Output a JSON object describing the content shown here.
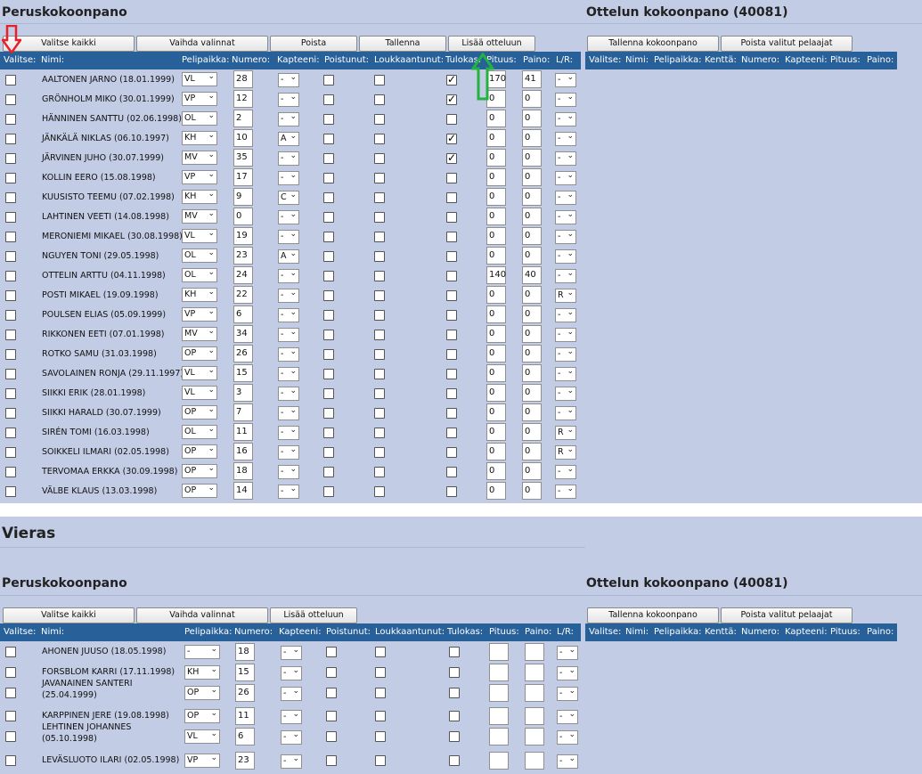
{
  "home": {
    "base_title": "Peruskokoonpano",
    "match_title": "Ottelun kokoonpano (40081)",
    "buttons": {
      "select_all": "Valitse kaikki",
      "invert": "Vaihda valinnat",
      "remove": "Poista",
      "save": "Tallenna",
      "add_to_match": "Lisää otteluun"
    },
    "match_buttons": {
      "save_lineup": "Tallenna kokoonpano",
      "remove_selected": "Poista valitut pelaajat"
    },
    "columns": {
      "select": "Valitse:",
      "name": "Nimi:",
      "position": "Pelipaikka:",
      "number": "Numero:",
      "captain": "Kapteeni:",
      "left": "Poistunut:",
      "injured": "Loukkaantunut:",
      "newcomer": "Tulokas:",
      "height": "Pituus:",
      "weight": "Paino:",
      "lr": "L/R:"
    },
    "match_columns": {
      "select": "Valitse:",
      "name": "Nimi:",
      "position": "Pelipaikka:",
      "field": "Kenttä:",
      "number": "Numero:",
      "captain": "Kapteeni:",
      "height": "Pituus:",
      "weight": "Paino:"
    },
    "players": [
      {
        "name": "AALTONEN JARNO (18.01.1999)",
        "position": "VL",
        "number": "28",
        "captain": "-",
        "newcomer": true,
        "height": "170",
        "weight": "41",
        "lr": "-"
      },
      {
        "name": "GRÖNHOLM MIKO (30.01.1999)",
        "position": "VP",
        "number": "12",
        "captain": "-",
        "newcomer": true,
        "height": "0",
        "weight": "0",
        "lr": "-"
      },
      {
        "name": "HÄNNINEN SANTTU (02.06.1998)",
        "position": "OL",
        "number": "2",
        "captain": "-",
        "newcomer": false,
        "height": "0",
        "weight": "0",
        "lr": "-"
      },
      {
        "name": "JÄNKÄLÄ NIKLAS (06.10.1997)",
        "position": "KH",
        "number": "10",
        "captain": "A",
        "newcomer": true,
        "height": "0",
        "weight": "0",
        "lr": "-"
      },
      {
        "name": "JÄRVINEN JUHO (30.07.1999)",
        "position": "MV",
        "number": "35",
        "captain": "-",
        "newcomer": true,
        "height": "0",
        "weight": "0",
        "lr": "-"
      },
      {
        "name": "KOLLIN EERO (15.08.1998)",
        "position": "VP",
        "number": "17",
        "captain": "-",
        "newcomer": false,
        "height": "0",
        "weight": "0",
        "lr": "-"
      },
      {
        "name": "KUUSISTO TEEMU (07.02.1998)",
        "position": "KH",
        "number": "9",
        "captain": "C",
        "newcomer": false,
        "height": "0",
        "weight": "0",
        "lr": "-"
      },
      {
        "name": "LAHTINEN VEETI (14.08.1998)",
        "position": "MV",
        "number": "0",
        "captain": "-",
        "newcomer": false,
        "height": "0",
        "weight": "0",
        "lr": "-"
      },
      {
        "name": "MERONIEMI MIKAEL (30.08.1998)",
        "position": "VL",
        "number": "19",
        "captain": "-",
        "newcomer": false,
        "height": "0",
        "weight": "0",
        "lr": "-"
      },
      {
        "name": "NGUYEN TONI (29.05.1998)",
        "position": "OL",
        "number": "23",
        "captain": "A",
        "newcomer": false,
        "height": "0",
        "weight": "0",
        "lr": "-"
      },
      {
        "name": "OTTELIN ARTTU (04.11.1998)",
        "position": "OL",
        "number": "24",
        "captain": "-",
        "newcomer": false,
        "height": "140",
        "weight": "40",
        "lr": "-"
      },
      {
        "name": "POSTI MIKAEL (19.09.1998)",
        "position": "KH",
        "number": "22",
        "captain": "-",
        "newcomer": false,
        "height": "0",
        "weight": "0",
        "lr": "R"
      },
      {
        "name": "POULSEN ELIAS (05.09.1999)",
        "position": "VP",
        "number": "6",
        "captain": "-",
        "newcomer": false,
        "height": "0",
        "weight": "0",
        "lr": "-"
      },
      {
        "name": "RIKKONEN EETI (07.01.1998)",
        "position": "MV",
        "number": "34",
        "captain": "-",
        "newcomer": false,
        "height": "0",
        "weight": "0",
        "lr": "-"
      },
      {
        "name": "ROTKO SAMU (31.03.1998)",
        "position": "OP",
        "number": "26",
        "captain": "-",
        "newcomer": false,
        "height": "0",
        "weight": "0",
        "lr": "-"
      },
      {
        "name": "SAVOLAINEN RONJA (29.11.1997)",
        "position": "VL",
        "number": "15",
        "captain": "-",
        "newcomer": false,
        "height": "0",
        "weight": "0",
        "lr": "-"
      },
      {
        "name": "SIIKKI ERIK (28.01.1998)",
        "position": "VL",
        "number": "3",
        "captain": "-",
        "newcomer": false,
        "height": "0",
        "weight": "0",
        "lr": "-"
      },
      {
        "name": "SIIKKI HARALD (30.07.1999)",
        "position": "OP",
        "number": "7",
        "captain": "-",
        "newcomer": false,
        "height": "0",
        "weight": "0",
        "lr": "-"
      },
      {
        "name": "SIRÉN TOMI (16.03.1998)",
        "position": "OL",
        "number": "11",
        "captain": "-",
        "newcomer": false,
        "height": "0",
        "weight": "0",
        "lr": "R"
      },
      {
        "name": "SOIKKELI ILMARI (02.05.1998)",
        "position": "OP",
        "number": "16",
        "captain": "-",
        "newcomer": false,
        "height": "0",
        "weight": "0",
        "lr": "R"
      },
      {
        "name": "TERVOMAA ERKKA (30.09.1998)",
        "position": "OP",
        "number": "18",
        "captain": "-",
        "newcomer": false,
        "height": "0",
        "weight": "0",
        "lr": "-"
      },
      {
        "name": "VÄLBE KLAUS (13.03.1998)",
        "position": "OP",
        "number": "14",
        "captain": "-",
        "newcomer": false,
        "height": "0",
        "weight": "0",
        "lr": "-"
      }
    ]
  },
  "away": {
    "section_title": "Vieras",
    "base_title": "Peruskokoonpano",
    "match_title": "Ottelun kokoonpano (40081)",
    "buttons": {
      "select_all": "Valitse kaikki",
      "invert": "Vaihda valinnat",
      "add_to_match": "Lisää otteluun"
    },
    "match_buttons": {
      "save_lineup": "Tallenna kokoonpano",
      "remove_selected": "Poista valitut pelaajat"
    },
    "columns": {
      "select": "Valitse:",
      "name": "Nimi:",
      "position": "Pelipaikka:",
      "number": "Numero:",
      "captain": "Kapteeni:",
      "left": "Poistunut:",
      "injured": "Loukkaantunut:",
      "newcomer": "Tulokas:",
      "height": "Pituus:",
      "weight": "Paino:",
      "lr": "L/R:"
    },
    "match_columns": {
      "select": "Valitse:",
      "name": "Nimi:",
      "position": "Pelipaikka:",
      "field": "Kenttä:",
      "number": "Numero:",
      "captain": "Kapteeni:",
      "height": "Pituus:",
      "weight": "Paino:"
    },
    "players": [
      {
        "name": "AHONEN JUUSO (18.05.1998)",
        "position": "-",
        "number": "18",
        "captain": "-",
        "height": "",
        "weight": "",
        "lr": "-"
      },
      {
        "name": "FORSBLOM KARRI (17.11.1998)",
        "position": "KH",
        "number": "15",
        "captain": "-",
        "height": "",
        "weight": "",
        "lr": "-"
      },
      {
        "name": "JAVANAINEN SANTERI (25.04.1999)",
        "position": "OP",
        "number": "26",
        "captain": "-",
        "height": "",
        "weight": "",
        "lr": "-"
      },
      {
        "name": "KARPPINEN JERE (19.08.1998)",
        "position": "OP",
        "number": "11",
        "captain": "-",
        "height": "",
        "weight": "",
        "lr": "-"
      },
      {
        "name": "LEHTINEN JOHANNES (05.10.1998)",
        "position": "VL",
        "number": "6",
        "captain": "-",
        "height": "",
        "weight": "",
        "lr": "-"
      },
      {
        "name": "LEVÄSLUOTO ILARI (02.05.1998)",
        "position": "VP",
        "number": "23",
        "captain": "-",
        "height": "",
        "weight": "",
        "lr": "-"
      }
    ]
  },
  "annotations": {
    "red_arrow_color": "#e8202a",
    "green_arrow_color": "#21b33d"
  }
}
